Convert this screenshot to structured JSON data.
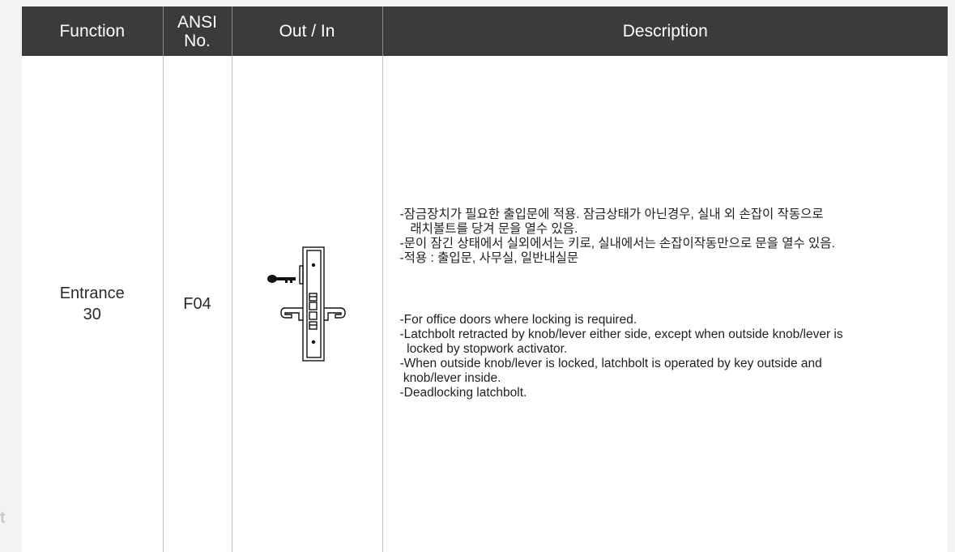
{
  "table": {
    "headers": {
      "function": "Function",
      "ansi_line1": "ANSI",
      "ansi_line2": "No.",
      "out_in": "Out / In",
      "description": "Description"
    },
    "row": {
      "function_line1": "Entrance",
      "function_line2": "30",
      "ansi_no": "F04",
      "description_ko": [
        "-잠금장치가 필요한 출입문에 적용. 잠금상태가 아닌경우, 실내 외 손잡이 작동으로",
        "   래치볼트를 당겨 문을 열수 있음.",
        "-문이 잠긴 상태에서 실외에서는 키로, 실내에서는 손잡이작동만으로 문을 열수 있음.",
        "-적용 : 출입문, 사무실, 일반내실문"
      ],
      "description_en": [
        "-For office doors where locking is required.",
        "-Latchbolt retracted by knob/lever either side, except when outside knob/lever is",
        "  locked by stopwork activator.",
        "-When outside knob/lever is locked, latchbolt is operated by key outside and",
        " knob/lever inside.",
        "-Deadlocking latchbolt."
      ]
    }
  },
  "side_fragment": "t",
  "icons": {
    "out_in": "mortise-lock-diagram-icon"
  }
}
